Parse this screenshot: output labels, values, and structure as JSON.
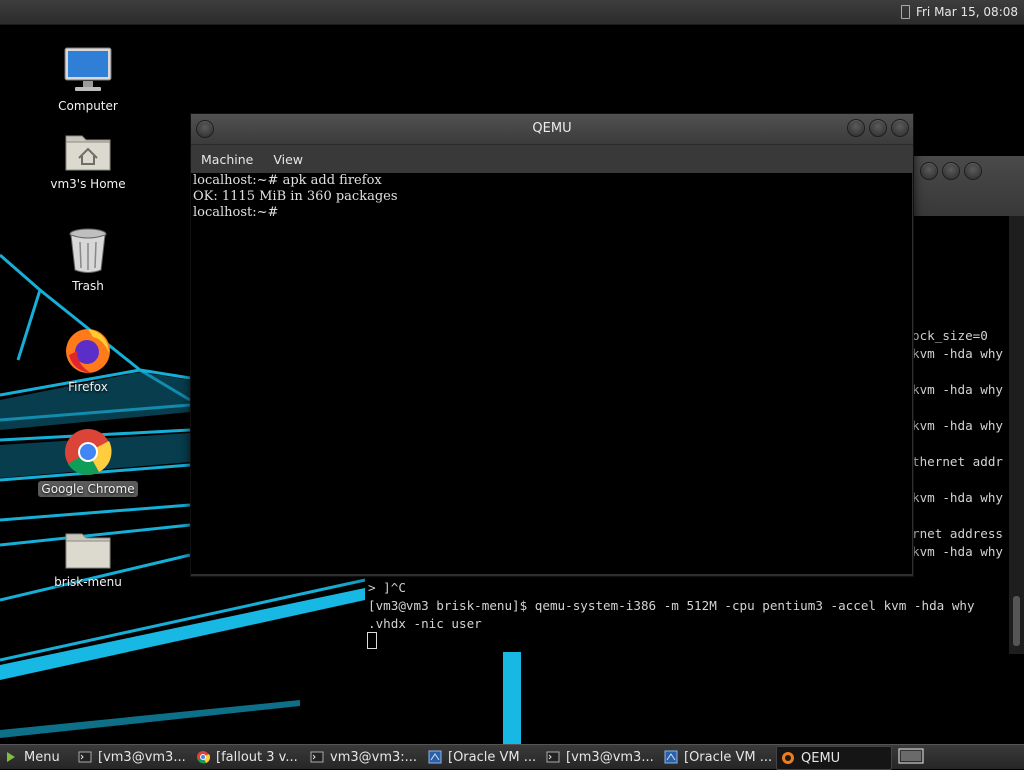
{
  "top_panel": {
    "clock": "Fri Mar 15, 08:08"
  },
  "desktop_icons": [
    {
      "label": "Computer",
      "icon": "computer-icon"
    },
    {
      "label": "vm3's Home",
      "icon": "home-folder-icon"
    },
    {
      "label": "Trash",
      "icon": "trash-icon"
    },
    {
      "label": "Firefox",
      "icon": "firefox-icon"
    },
    {
      "label": "Google Chrome",
      "icon": "chrome-icon",
      "selected": true
    },
    {
      "label": "brisk-menu",
      "icon": "folder-icon"
    }
  ],
  "qemu_window": {
    "title": "QEMU",
    "menu": [
      "Machine",
      "View"
    ],
    "screen_lines": [
      "localhost:~# apk add firefox",
      "OK: 1115 MiB in 360 packages",
      "localhost:~#"
    ]
  },
  "background_terminal": {
    "lines": [
      "ock_size=0",
      "kvm -hda why",
      "kvm -hda why",
      "kvm -hda why",
      "thernet addr",
      "kvm -hda why",
      "rnet address",
      "kvm -hda why",
      "> ]^C",
      "[vm3@vm3 brisk-menu]$ qemu-system-i386 -m 512M -cpu pentium3 -accel kvm -hda why",
      ".vhdx -nic user"
    ]
  },
  "taskbar": {
    "menu_label": "Menu",
    "tasks": [
      {
        "label": "[vm3@vm3...",
        "icon": "terminal-icon"
      },
      {
        "label": "[fallout 3 v...",
        "icon": "chrome-icon"
      },
      {
        "label": "vm3@vm3:...",
        "icon": "terminal-icon"
      },
      {
        "label": "[Oracle VM ...",
        "icon": "virtualbox-icon"
      },
      {
        "label": "[vm3@vm3...",
        "icon": "terminal-icon"
      },
      {
        "label": "[Oracle VM ...",
        "icon": "virtualbox-icon"
      },
      {
        "label": "QEMU",
        "icon": "qemu-icon",
        "active": true
      }
    ]
  },
  "colors": {
    "wallpaper_neon": "#16c0e8",
    "panel": "#2f2f2f",
    "selection": "#5a5a5a"
  }
}
